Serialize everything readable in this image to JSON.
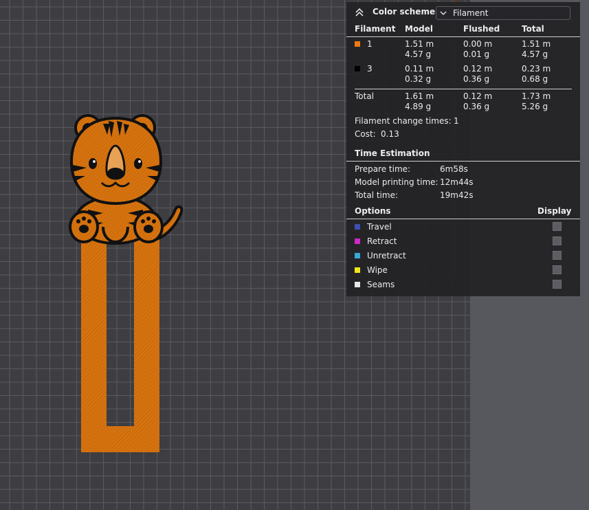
{
  "panel": {
    "header": {
      "title": "Color scheme",
      "selected_scheme": "Filament",
      "collapse_icon": "chevrons-up-icon",
      "dropdown_icon": "chevron-down-icon"
    },
    "filament_table": {
      "columns": [
        "Filament",
        "Model",
        "Flushed",
        "Total"
      ],
      "rows": [
        {
          "id": "1",
          "color": "#f07a10",
          "model_len": "1.51 m",
          "model_wt": "4.57 g",
          "flushed_len": "0.00 m",
          "flushed_wt": "0.01 g",
          "total_len": "1.51 m",
          "total_wt": "4.57 g"
        },
        {
          "id": "3",
          "color": "#000000",
          "model_len": "0.11 m",
          "model_wt": "0.32 g",
          "flushed_len": "0.12 m",
          "flushed_wt": "0.36 g",
          "total_len": "0.23 m",
          "total_wt": "0.68 g"
        }
      ],
      "total": {
        "label": "Total",
        "model_len": "1.61 m",
        "model_wt": "4.89 g",
        "flushed_len": "0.12 m",
        "flushed_wt": "0.36 g",
        "total_len": "1.73 m",
        "total_wt": "5.26 g"
      }
    },
    "filament_change": {
      "label": "Filament change times:",
      "value": "1"
    },
    "cost": {
      "label": "Cost:",
      "value": "0.13"
    },
    "time_estimation": {
      "title": "Time Estimation",
      "prepare": {
        "label": "Prepare time:",
        "value": "6m58s"
      },
      "model_printing": {
        "label": "Model printing time:",
        "value": "12m44s"
      },
      "total": {
        "label": "Total time:",
        "value": "19m42s"
      }
    },
    "options": {
      "title": "Options",
      "display_label": "Display",
      "items": [
        {
          "label": "Travel",
          "color": "#3d4fb0"
        },
        {
          "label": "Retract",
          "color": "#d028c8"
        },
        {
          "label": "Unretract",
          "color": "#3aa8d8"
        },
        {
          "label": "Wipe",
          "color": "#f2e51a"
        },
        {
          "label": "Seams",
          "color": "#e8e8e8"
        }
      ]
    }
  },
  "colors": {
    "filament_orange": "#d6730f",
    "filament_black": "#111111",
    "bed": "#3d3d42",
    "grid": "#5a5a60"
  }
}
